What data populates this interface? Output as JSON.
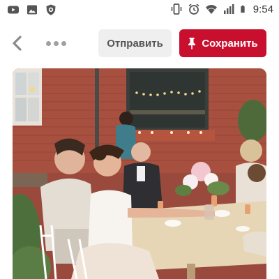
{
  "status_bar": {
    "time": "9:54",
    "left_icons": [
      "youtube-icon",
      "gallery-icon",
      "shield-icon"
    ],
    "right_icons": [
      "vibrate-icon",
      "alarm-icon",
      "wifi-icon",
      "signal-icon",
      "battery-icon"
    ]
  },
  "action_bar": {
    "back_icon": "chevron-left-icon",
    "more_icon": "more-horizontal-icon",
    "send_label": "Отправить",
    "save_label": "Сохранить",
    "save_icon": "pin-icon"
  },
  "colors": {
    "save_button": "#c8102e",
    "send_button": "#efefef",
    "text_muted": "#555555"
  },
  "pin_image": {
    "subject": "outdoor wedding dinner"
  }
}
